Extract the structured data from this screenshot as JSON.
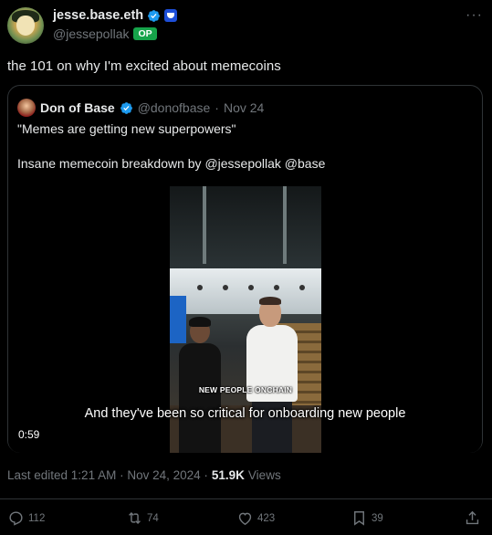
{
  "post": {
    "author": {
      "display_name": "jesse.base.eth",
      "handle": "@jessepollak",
      "badge": "OP"
    },
    "text": "the 101 on why I'm excited about memecoins",
    "quote": {
      "display_name": "Don of Base",
      "handle": "@donofbase",
      "separator": "·",
      "date": "Nov 24",
      "line1": "\"Memes are getting new superpowers\"",
      "line2": "Insane memecoin breakdown by @jessepollak @base",
      "video": {
        "overlay_text": "NEW PEOPLE ONCHAIN",
        "caption": "And they've been so critical for onboarding new people",
        "duration": "0:59"
      }
    },
    "meta": {
      "edited": "Last edited 1:21 AM · Nov 24, 2024 ·",
      "views_count": "51.9K",
      "views_label": "Views"
    },
    "actions": {
      "replies": "112",
      "reposts": "74",
      "likes": "423",
      "bookmarks": "39"
    },
    "icons": [
      "verified-icon",
      "affiliate-badge-icon",
      "more-icon",
      "reply-icon",
      "repost-icon",
      "like-icon",
      "bookmark-icon",
      "share-icon"
    ],
    "colors": {
      "background": "#000000",
      "text": "#e7e9ea",
      "secondary": "#71767b",
      "verified": "#1d9bf0",
      "op_badge": "#16a34a"
    }
  }
}
